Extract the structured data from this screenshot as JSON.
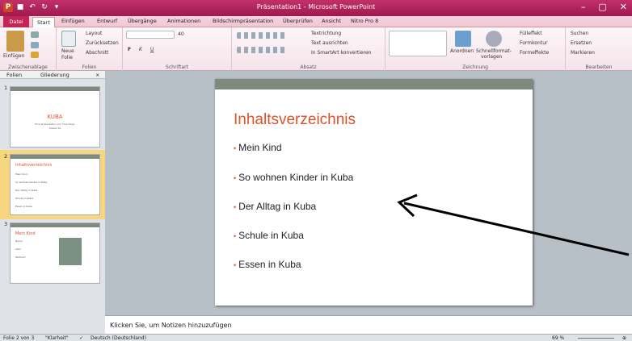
{
  "window": {
    "title": "Präsentation1 - Microsoft PowerPoint"
  },
  "tabs": [
    "Datei",
    "Start",
    "Einfügen",
    "Entwurf",
    "Übergänge",
    "Animationen",
    "Bildschirmpräsentation",
    "Überprüfen",
    "Ansicht",
    "Nitro Pro 8"
  ],
  "ribbon": {
    "zwischenablage": {
      "label": "Zwischenablage",
      "einfuegen": "Einfügen"
    },
    "folien": {
      "label": "Folien",
      "neue": "Neue",
      "folie": "Folie",
      "layout": "Layout",
      "zurueck": "Zurücksetzen",
      "abschnitt": "Abschnitt"
    },
    "schriftart": {
      "label": "Schriftart",
      "size": "40",
      "bold": "F",
      "italic": "K",
      "underline": "U"
    },
    "absatz": {
      "label": "Absatz",
      "textrichtung": "Textrichtung",
      "ausrichten": "Text ausrichten",
      "smartart": "In SmartArt konvertieren"
    },
    "zeichnung": {
      "label": "Zeichnung",
      "anordnen": "Anordnen",
      "schnell": "Schnellformat-",
      "vorlagen": "vorlagen",
      "fuelleffekt": "Fülleffekt",
      "formkontur": "Formkontur",
      "formeffekte": "Formeffekte"
    },
    "bearbeiten": {
      "label": "Bearbeiten",
      "suchen": "Suchen",
      "ersetzen": "Ersetzen",
      "markieren": "Markieren"
    }
  },
  "leftpane": {
    "tab_folien": "Folien",
    "tab_gliederung": "Gliederung",
    "close": "×"
  },
  "thumbs": [
    {
      "num": "1",
      "title": "KUBA",
      "sub1": "Eine Präsentation von Tina Maier",
      "sub2": "Klasse 3a"
    },
    {
      "num": "2",
      "title": "Inhaltsverzeichnis",
      "items": [
        "Mein Kind",
        "So wohnen Kinder in Kuba",
        "Der Alltag in Kuba",
        "Schule in Kuba",
        "Essen in Kuba"
      ]
    },
    {
      "num": "3",
      "title": "Mein Kind",
      "items": [
        "Name",
        "Alter",
        "Wohnort"
      ]
    }
  ],
  "slide": {
    "title": "Inhaltsverzeichnis",
    "bullets": [
      "Mein Kind",
      "So wohnen  Kinder  in Kuba",
      "Der Alltag  in Kuba",
      "Schule  in Kuba",
      "Essen  in Kuba"
    ]
  },
  "notes": {
    "placeholder": "Klicken Sie, um Notizen hinzuzufügen"
  },
  "status": {
    "slide": "Folie 2 von 3",
    "theme": "\"Klarheit\"",
    "lang": "Deutsch (Deutschland)",
    "zoom": "69 %"
  }
}
